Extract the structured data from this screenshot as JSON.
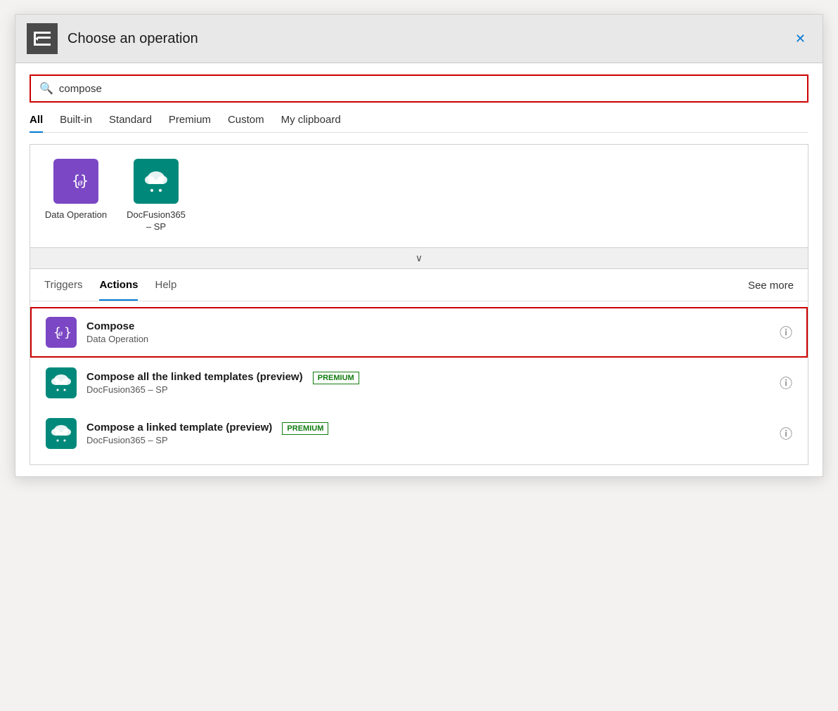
{
  "dialog": {
    "title": "Choose an operation",
    "close_label": "✕"
  },
  "search": {
    "placeholder": "compose",
    "value": "compose"
  },
  "tabs": [
    {
      "label": "All",
      "active": true
    },
    {
      "label": "Built-in",
      "active": false
    },
    {
      "label": "Standard",
      "active": false
    },
    {
      "label": "Premium",
      "active": false
    },
    {
      "label": "Custom",
      "active": false
    },
    {
      "label": "My clipboard",
      "active": false
    }
  ],
  "connectors": [
    {
      "name": "Data Operation",
      "color": "purple",
      "icon": "{ø}"
    },
    {
      "name": "DocFusion365 – SP",
      "color": "teal",
      "icon": "cloud"
    }
  ],
  "lower_tabs": [
    {
      "label": "Triggers",
      "active": false
    },
    {
      "label": "Actions",
      "active": true
    },
    {
      "label": "Help",
      "active": false
    }
  ],
  "see_more_label": "See more",
  "results": [
    {
      "title": "Compose",
      "subtitle": "Data Operation",
      "color": "purple",
      "selected": true,
      "premium": false
    },
    {
      "title": "Compose all the linked templates (preview)",
      "subtitle": "DocFusion365 – SP",
      "color": "teal",
      "selected": false,
      "premium": true
    },
    {
      "title": "Compose a linked template (preview)",
      "subtitle": "DocFusion365 – SP",
      "color": "teal",
      "selected": false,
      "premium": true
    }
  ],
  "premium_label": "PREMIUM",
  "collapse_icon": "∨"
}
